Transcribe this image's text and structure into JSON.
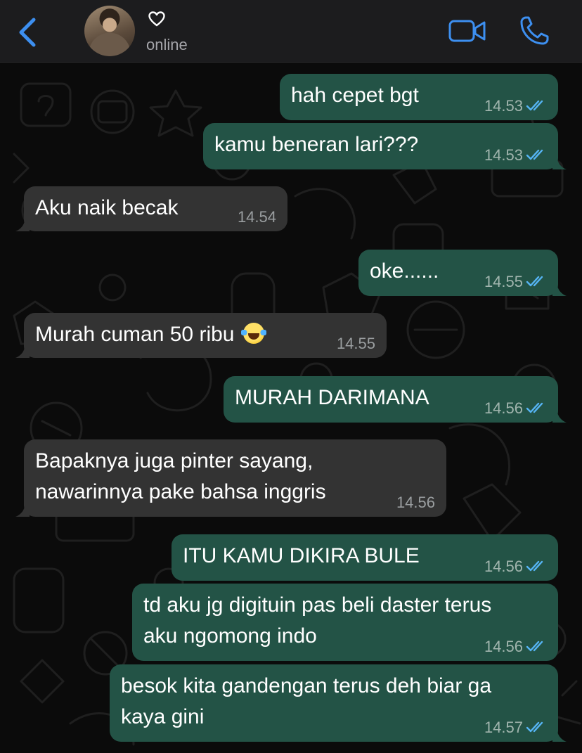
{
  "header": {
    "contact_name_icon": "heart-icon",
    "status": "online"
  },
  "messages": [
    {
      "dir": "out",
      "text": "hah cepet bgt",
      "time": "14.53",
      "read": true
    },
    {
      "dir": "out",
      "text": "kamu beneran lari???",
      "time": "14.53",
      "read": true
    },
    {
      "dir": "in",
      "text": "Aku naik becak",
      "time": "14.54"
    },
    {
      "dir": "out",
      "text": "oke......",
      "time": "14.55",
      "read": true
    },
    {
      "dir": "in",
      "text": "Murah cuman 50 ribu",
      "emoji": "face-with-tears-of-joy",
      "time": "14.55"
    },
    {
      "dir": "out",
      "text": "MURAH DARIMANA",
      "time": "14.56",
      "read": true
    },
    {
      "dir": "in",
      "text": "Bapaknya juga pinter sayang,\nnawarinnya pake bahsa inggris",
      "time": "14.56"
    },
    {
      "dir": "out",
      "text": "ITU KAMU DIKIRA BULE",
      "time": "14.56",
      "read": true
    },
    {
      "dir": "out",
      "text": "td aku jg digituin pas beli daster terus\naku ngomong indo",
      "time": "14.56",
      "read": true
    },
    {
      "dir": "out",
      "text": "besok kita gandengan terus deh biar ga\nkaya gini",
      "time": "14.57",
      "read": true
    }
  ],
  "colors": {
    "accent": "#3d8ff0",
    "outgoing_bubble": "#235346",
    "incoming_bubble": "#333333",
    "background": "#0b0b0b",
    "read_ticks": "#56b4f4"
  }
}
